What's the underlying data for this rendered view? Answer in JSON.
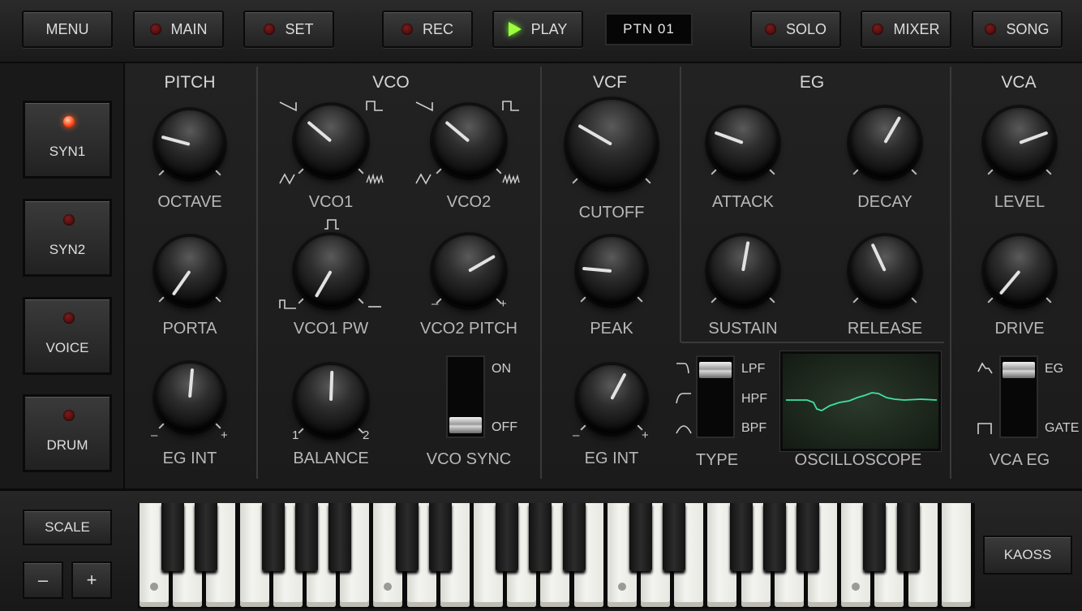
{
  "topbar": {
    "menu": "MENU",
    "main": "MAIN",
    "set": "SET",
    "rec": "REC",
    "play": "PLAY",
    "pattern": "PTN 01",
    "solo": "SOLO",
    "mixer": "MIXER",
    "song": "SONG"
  },
  "sidebar": {
    "items": [
      {
        "label": "SYN1",
        "active": true
      },
      {
        "label": "SYN2",
        "active": false
      },
      {
        "label": "VOICE",
        "active": false
      },
      {
        "label": "DRUM",
        "active": false
      }
    ]
  },
  "sections": {
    "pitch": "PITCH",
    "vco": "VCO",
    "vcf": "VCF",
    "eg": "EG",
    "vca": "VCA"
  },
  "knobs": {
    "octave": "OCTAVE",
    "porta": "PORTA",
    "eg_int_pitch": "EG INT",
    "vco1": "VCO1",
    "vco2": "VCO2",
    "vco1_pw": "VCO1 PW",
    "vco2_pitch": "VCO2 PITCH",
    "balance": "BALANCE",
    "vco_sync": "VCO SYNC",
    "cutoff": "CUTOFF",
    "peak": "PEAK",
    "eg_int_vcf": "EG INT",
    "attack": "ATTACK",
    "decay": "DECAY",
    "sustain": "SUSTAIN",
    "release": "RELEASE",
    "level": "LEVEL",
    "drive": "DRIVE"
  },
  "marks": {
    "minus": "–",
    "plus": "+",
    "one": "1",
    "two": "2",
    "on": "ON",
    "off": "OFF"
  },
  "filter_type": {
    "label": "TYPE",
    "lpf": "LPF",
    "hpf": "HPF",
    "bpf": "BPF"
  },
  "oscilloscope": {
    "label": "OSCILLOSCOPE",
    "trace_color": "#3fe0a8"
  },
  "vca_eg": {
    "label": "VCA EG",
    "eg": "EG",
    "gate": "GATE"
  },
  "keyboard": {
    "scale": "SCALE",
    "minus": "–",
    "plus": "+",
    "kaoss": "KAOSS"
  }
}
